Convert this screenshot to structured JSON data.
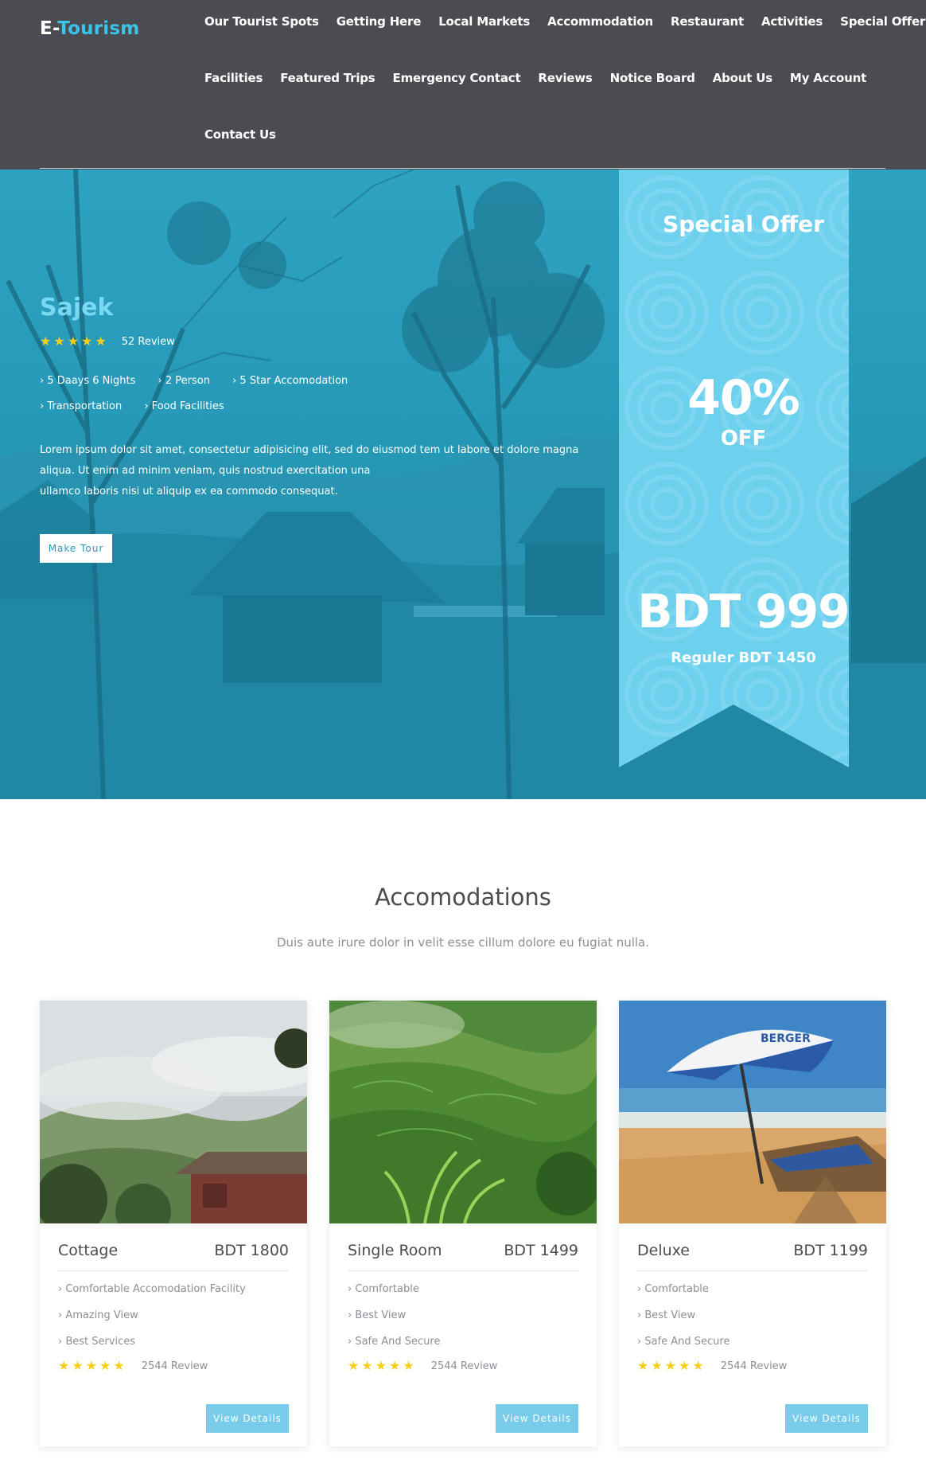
{
  "brand": {
    "part1": "E-",
    "part2": "Tourism"
  },
  "nav": {
    "row1": [
      "Our Tourist Spots",
      "Getting Here",
      "Local Markets",
      "Accommodation",
      "Restaurant",
      "Activities",
      "Special Offer"
    ],
    "row2": [
      "Facilities",
      "Featured Trips",
      "Emergency Contact",
      "Reviews",
      "Notice Board",
      "About Us",
      "My Account"
    ],
    "row3": [
      "Contact Us"
    ]
  },
  "hero": {
    "title": "Sajek",
    "rating": 5,
    "review_label": "52 Review",
    "features": [
      "› 5 Daays 6 Nights",
      "› 2 Person",
      "› 5 Star Accomodation",
      "› Transportation",
      "› Food Facilities"
    ],
    "description_lines": [
      "Lorem ipsum dolor sit amet, consectetur adipisicing elit, sed do eiusmod tem ut labore et dolore magna",
      "aliqua. Ut enim ad minim veniam, quis nostrud exercitation una",
      "ullamco laboris nisi ut aliquip ex ea commodo consequat."
    ],
    "button_label": "Make Tour"
  },
  "offer": {
    "title": "Special Offer",
    "percent": "40%",
    "off_label": "OFF",
    "price": "BDT 999",
    "regular": "Reguler BDT 1450"
  },
  "accommodations": {
    "title": "Accomodations",
    "subtitle": "Duis aute irure dolor in velit esse cillum dolore eu fugiat nulla.",
    "cards": [
      {
        "name": "Cottage",
        "price": "BDT 1800",
        "features": [
          "› Comfortable Accomodation Facility",
          "› Amazing View",
          "› Best Services"
        ],
        "rating": 5,
        "review_label": "2544 Review",
        "button_label": "View Details"
      },
      {
        "name": "Single Room",
        "price": "BDT 1499",
        "features": [
          "› Comfortable",
          "› Best View",
          "› Safe And Secure"
        ],
        "rating": 5,
        "review_label": "2544 Review",
        "button_label": "View Details"
      },
      {
        "name": "Deluxe",
        "price": "BDT 1199",
        "features": [
          "› Comfortable",
          "› Best View",
          "› Safe And Secure"
        ],
        "rating": 5,
        "review_label": "2544 Review",
        "button_label": "View Details"
      }
    ]
  },
  "image_labels": {
    "umbrella_text": "BERGER"
  },
  "colors": {
    "header_bg": "#4a4c52",
    "brand_accent": "#3cc3e8",
    "hero_teal": "#2598b6",
    "ribbon": "#6dd0ed",
    "star": "#f6cf1a",
    "button_blue": "#79cbea"
  }
}
